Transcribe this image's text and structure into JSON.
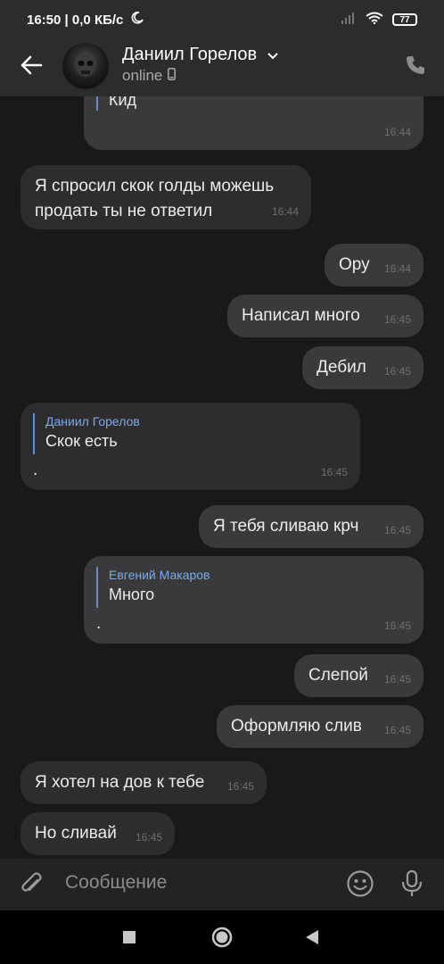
{
  "status": {
    "time": "16:50",
    "network": "0,0 КБ/с",
    "battery": "77"
  },
  "header": {
    "peer_name": "Даниил Горелов",
    "peer_status": "online"
  },
  "messages": [
    {
      "reply_text": "Кид",
      "time": "16:44"
    },
    {
      "text1": "Я спросил скок голды можешь",
      "text2": "продать ты не ответил",
      "time": "16:44"
    },
    {
      "text": "Ору",
      "time": "16:44"
    },
    {
      "text": "Написал много",
      "time": "16:45"
    },
    {
      "text": "Дебил",
      "time": "16:45"
    },
    {
      "reply_name": "Даниил Горелов",
      "reply_text": "Скок есть",
      "text": ".",
      "time": "16:45"
    },
    {
      "text": "Я тебя сливаю крч",
      "time": "16:45"
    },
    {
      "reply_name": "Евгений Макаров",
      "reply_text": "Много",
      "text": ".",
      "time": "16:45"
    },
    {
      "text": "Слепой",
      "time": "16:45"
    },
    {
      "text": "Оформляю слив",
      "time": "16:45"
    },
    {
      "text": "Я хотел на дов к тебе",
      "time": "16:45"
    },
    {
      "text": "Но сливай",
      "time": "16:45"
    }
  ],
  "composer": {
    "placeholder": "Сообщение"
  }
}
